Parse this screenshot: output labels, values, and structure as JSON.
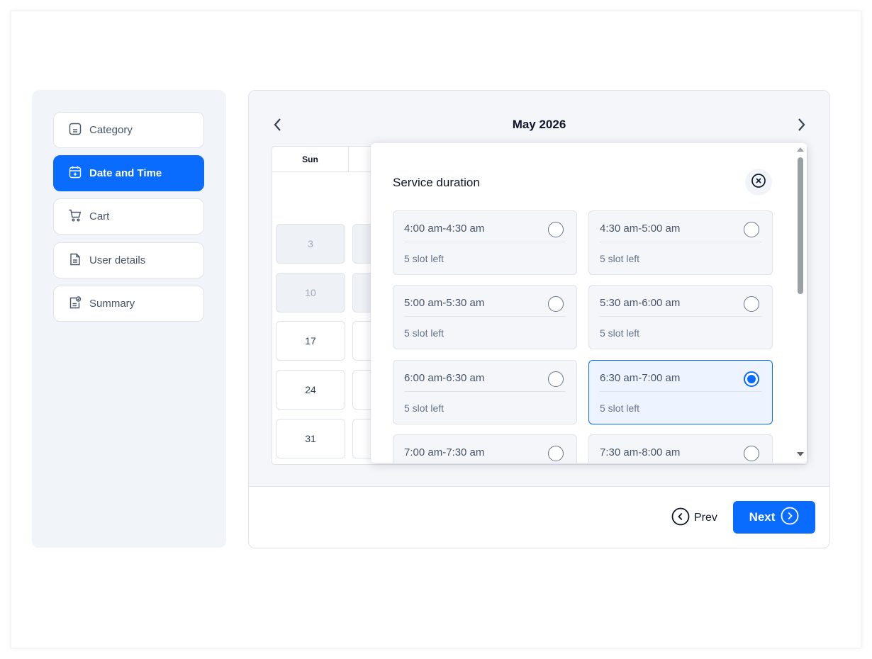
{
  "sidebar": {
    "items": [
      {
        "label": "Category",
        "icon": "category-icon",
        "active": false
      },
      {
        "label": "Date and Time",
        "icon": "calendar-icon",
        "active": true
      },
      {
        "label": "Cart",
        "icon": "cart-icon",
        "active": false
      },
      {
        "label": "User details",
        "icon": "document-icon",
        "active": false
      },
      {
        "label": "Summary",
        "icon": "summary-icon",
        "active": false
      }
    ]
  },
  "calendar": {
    "month": "May 2026",
    "prev_icon": "chevron-left-icon",
    "next_icon": "chevron-right-icon",
    "visible_weekday": "Sun",
    "days": [
      {
        "label": "3",
        "disabled": true
      },
      {
        "label": "10",
        "disabled": true
      },
      {
        "label": "17",
        "disabled": false
      },
      {
        "label": "24",
        "disabled": false
      },
      {
        "label": "31",
        "disabled": false
      }
    ]
  },
  "popup": {
    "title": "Service duration",
    "close_icon": "close-circle-icon",
    "slots": [
      {
        "time": "4:00 am-4:30 am",
        "left": "5 slot left",
        "selected": false
      },
      {
        "time": "4:30 am-5:00 am",
        "left": "5 slot left",
        "selected": false
      },
      {
        "time": "5:00 am-5:30 am",
        "left": "5 slot left",
        "selected": false
      },
      {
        "time": "5:30 am-6:00 am",
        "left": "5 slot left",
        "selected": false
      },
      {
        "time": "6:00 am-6:30 am",
        "left": "5 slot left",
        "selected": false
      },
      {
        "time": "6:30 am-7:00 am",
        "left": "5 slot left",
        "selected": true
      },
      {
        "time": "7:00 am-7:30 am",
        "left": "",
        "selected": false
      },
      {
        "time": "7:30 am-8:00 am",
        "left": "",
        "selected": false
      }
    ]
  },
  "footer": {
    "prev_label": "Prev",
    "next_label": "Next"
  },
  "colors": {
    "accent": "#0a6cff",
    "panel_bg": "#f1f5f9",
    "border": "#dfe3ea"
  }
}
